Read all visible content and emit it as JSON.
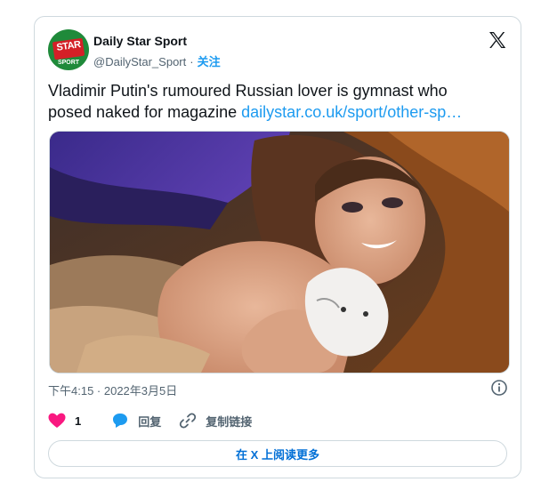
{
  "account": {
    "name": "Daily Star Sport",
    "handle": "@DailyStar_Sport",
    "separator": "·",
    "follow_label": "关注",
    "logo_text": "STAR",
    "logo_sub": "SPORT"
  },
  "tweet": {
    "text": "Vladimir Putin's rumoured Russian lover is gymnast who posed naked for magazine ",
    "link": "dailystar.co.uk/sport/other-sp…",
    "timestamp": "下午4:15 · 2022年3月5日"
  },
  "actions": {
    "like_count": "1",
    "reply_label": "回复",
    "copy_link_label": "复制链接"
  },
  "read_more_label": "在 X 上阅读更多",
  "colors": {
    "accent": "#1d9bf0",
    "like": "#f91880",
    "border": "#cfd9de",
    "muted": "#536471"
  },
  "icons": [
    "x-logo-icon",
    "info-icon",
    "heart-icon",
    "reply-bubble-icon",
    "link-icon"
  ]
}
